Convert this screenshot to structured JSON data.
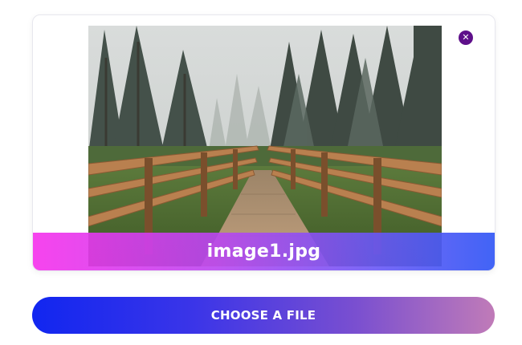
{
  "upload_card": {
    "filename": "image1.jpg",
    "close_icon": "close-icon",
    "preview_subject": "misty-forest-boardwalk-photo",
    "gradient_colors": [
      "#f634ec",
      "#ba46f0",
      "#6758f6",
      "#375bf5"
    ]
  },
  "actions": {
    "choose_file_label": "CHOOSE A FILE",
    "gradient_colors": [
      "#1126f0",
      "#3b35e8",
      "#7a4fd0",
      "#c07bb8"
    ]
  },
  "colors": {
    "close_button": "#5e0f8a"
  }
}
